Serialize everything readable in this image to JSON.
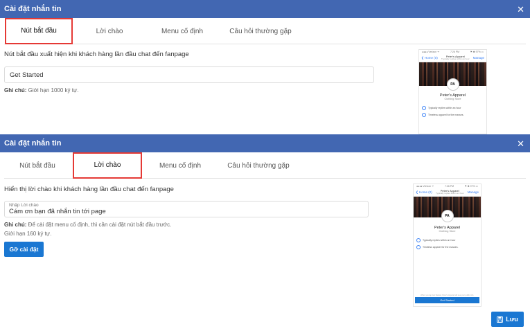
{
  "modal_title": "Cài đặt nhắn tin",
  "close_symbol": "✕",
  "tabs": [
    "Nút bắt đầu",
    "Lời chào",
    "Menu cố định",
    "Câu hỏi thường gặp"
  ],
  "panel1": {
    "description": "Nút bắt đầu xuất hiện khi khách hàng lần đầu chat đến fanpage",
    "input_value": "Get Started",
    "note_label": "Ghi chú:",
    "note_text": " Giới hạn 1000 ký tự."
  },
  "panel2": {
    "description": "Hiển thị lời chào khi khách hàng lần đầu chat đến fanpage",
    "input_label": "Nhập Lời chào",
    "input_value": "Cám ơn bạn đã nhắn tin tới page",
    "note_label": "Ghi chú:",
    "note_text": " Để cài đặt menu cố định, thì cần cài đặt nút bắt đầu trước.",
    "limit_text": "Giới hạn 160 ký tự.",
    "setup_button": "Gỡ cài đặt"
  },
  "save_button": "Lưu",
  "colors": {
    "header": "#4267b2",
    "primary": "#1a77d2",
    "highlight": "#e53935"
  },
  "phone_preview": {
    "status_carrier": "●●●● Verizon ᯤ",
    "status_time": "7:26 PM",
    "status_battery": "⚑ ✱ 97% ▭",
    "back": "❮ Home (0)",
    "page_name": "Peter's Apparel",
    "page_sub": "Typically replies within an hour",
    "manage": "Manage",
    "logo": "PA",
    "name": "Peter's Apparel",
    "category": "Clothing Store",
    "row1": "Typically replies within an hour",
    "row2": "Timeless apparel for the masses.",
    "fine_print": "When you tap Get Started, Peter's Apparel will see your public info.",
    "cta": "Get Started"
  }
}
